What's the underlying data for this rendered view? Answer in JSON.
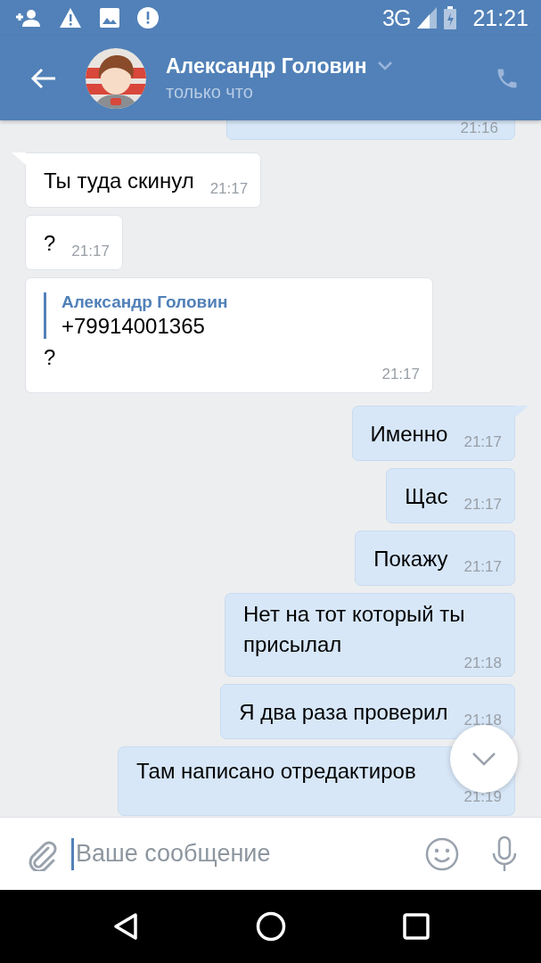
{
  "status_bar": {
    "network": "3G",
    "time": "21:21"
  },
  "header": {
    "name": "Александр Головин",
    "status": "только что"
  },
  "messages": [
    {
      "kind": "partial",
      "outgoing": true,
      "time": "21:16"
    },
    {
      "kind": "text",
      "outgoing": false,
      "tail": true,
      "text": "Ты туда скинул",
      "time": "21:17"
    },
    {
      "kind": "text",
      "outgoing": false,
      "tail": false,
      "text": "?",
      "time": "21:17"
    },
    {
      "kind": "reply",
      "outgoing": false,
      "tail": false,
      "quote_author": "Александр Головин",
      "quote_text": "+79914001365",
      "text": "?",
      "time": "21:17"
    },
    {
      "kind": "text",
      "outgoing": true,
      "tail": true,
      "text": "Именно",
      "time": "21:17"
    },
    {
      "kind": "text",
      "outgoing": true,
      "tail": false,
      "text": "Щас",
      "time": "21:17"
    },
    {
      "kind": "text",
      "outgoing": true,
      "tail": false,
      "text": "Покажу",
      "time": "21:17"
    },
    {
      "kind": "wrap",
      "outgoing": true,
      "tail": false,
      "text": "Нет на тот который ты присылал",
      "time": "21:18"
    },
    {
      "kind": "text",
      "outgoing": true,
      "tail": false,
      "text": "Я два раза проверил",
      "time": "21:18"
    },
    {
      "kind": "wrap",
      "outgoing": true,
      "tail": false,
      "text": "Там написано отредактиров",
      "time": "21:19"
    }
  ],
  "composer": {
    "placeholder": "Ваше сообщение"
  }
}
